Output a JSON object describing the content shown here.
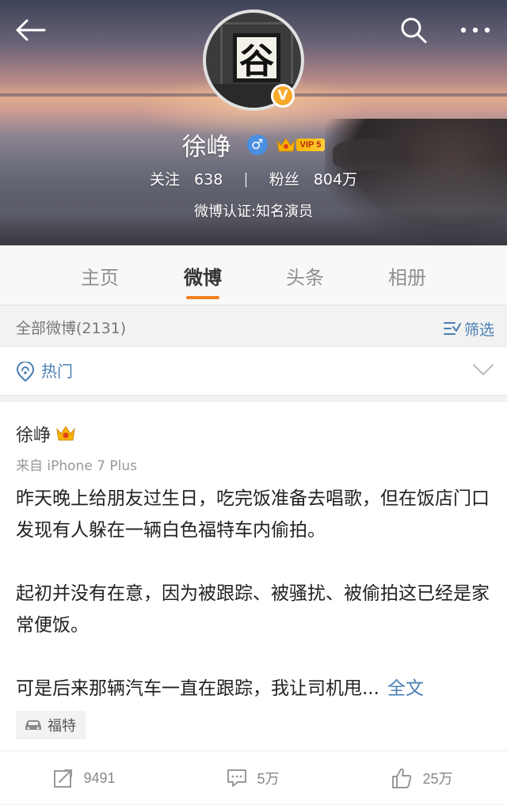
{
  "header": {
    "name": "徐峥",
    "vip_label": "VIP 5",
    "follow_label": "关注",
    "follow_count": "638",
    "separator": "|",
    "fans_label": "粉丝",
    "fans_count": "804万",
    "verification": "微博认证:知名演员",
    "avatar_text": "谷",
    "icons": {
      "back": "back-arrow-icon",
      "search": "search-icon",
      "more": "more-dots-icon",
      "verified": "verified-v-icon",
      "gender": "male-icon",
      "vip": "crown-icon"
    }
  },
  "tabs": [
    {
      "label": "主页",
      "active": false
    },
    {
      "label": "微博",
      "active": true
    },
    {
      "label": "头条",
      "active": false
    },
    {
      "label": "相册",
      "active": false
    }
  ],
  "filter_bar": {
    "all_label": "全部微博(2131)",
    "filter_label": "筛选"
  },
  "hot_bar": {
    "label": "热门"
  },
  "post": {
    "author": "徐峥",
    "source": "来自 iPhone 7 Plus",
    "paragraphs": [
      "昨天晚上给朋友过生日，吃完饭准备去唱歌，但在饭店门口发现有人躲在一辆白色福特车内偷拍。",
      "起初并没有在意，因为被跟踪、被骚扰、被偷拍这已经是家常便饭。",
      "可是后来那辆汽车一直在跟踪，我让司机甩..."
    ],
    "full_text_label": "全文",
    "topic": "福特",
    "actions": {
      "repost_count": "9491",
      "comment_count": "5万",
      "like_count": "25万"
    }
  },
  "colors": {
    "accent_orange": "#f48024",
    "link_blue": "#4a7fb4",
    "verified_gold": "#f7a92a",
    "gender_blue": "#4a8fe0"
  }
}
